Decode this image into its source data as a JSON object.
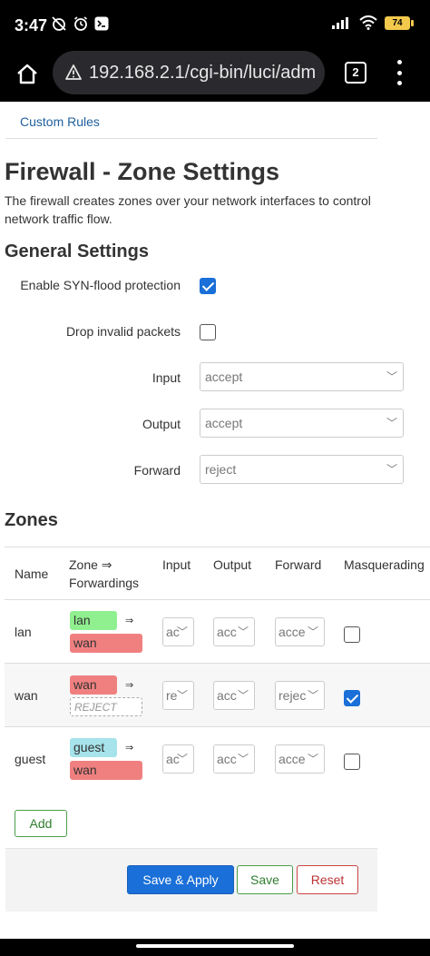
{
  "status_bar": {
    "time": "3:47",
    "battery": "74",
    "icons": [
      "muted-alarm-icon",
      "alarm-icon",
      "terminal-icon",
      "signal-icon",
      "wifi-icon",
      "battery-icon"
    ]
  },
  "browser": {
    "url": "192.168.2.1/cgi-bin/luci/adm",
    "tab_count": "2"
  },
  "page": {
    "tab_link": "Custom Rules",
    "title": "Firewall - Zone Settings",
    "description": "The firewall creates zones over your network interfaces to control network traffic flow."
  },
  "general": {
    "title": "General Settings",
    "syn_flood_label": "Enable SYN-flood protection",
    "syn_flood_checked": true,
    "drop_invalid_label": "Drop invalid packets",
    "drop_invalid_checked": false,
    "input_label": "Input",
    "input_value": "accept",
    "output_label": "Output",
    "output_value": "accept",
    "forward_label": "Forward",
    "forward_value": "reject"
  },
  "zones": {
    "title": "Zones",
    "headers": {
      "name": "Name",
      "zone_forwardings_1": "Zone ⇒",
      "zone_forwardings_2": "Forwardings",
      "input": "Input",
      "output": "Output",
      "forward": "Forward",
      "masquerading": "Masquerading"
    },
    "rows": [
      {
        "name": "lan",
        "zone": "lan",
        "zone_color": "#90f090",
        "target": "wan",
        "target_color": "#f08080",
        "input": "ac",
        "output": "acc",
        "forward": "acce",
        "masq": false
      },
      {
        "name": "wan",
        "zone": "wan",
        "zone_color": "#f08080",
        "target": "REJECT",
        "target_color": "#ffffff",
        "input": "re",
        "output": "acc",
        "forward": "rejec",
        "masq": true
      },
      {
        "name": "guest",
        "zone": "guest",
        "zone_color": "#a6e3ea",
        "target": "wan",
        "target_color": "#f08080",
        "input": "ac",
        "output": "acc",
        "forward": "acce",
        "masq": false
      }
    ],
    "add_label": "Add"
  },
  "actions": {
    "save_apply": "Save & Apply",
    "save": "Save",
    "reset": "Reset"
  },
  "colors": {
    "accent": "#1a6fd8",
    "link": "#1f5f9e",
    "positive": "#2f7d2f",
    "negative": "#b33333"
  }
}
